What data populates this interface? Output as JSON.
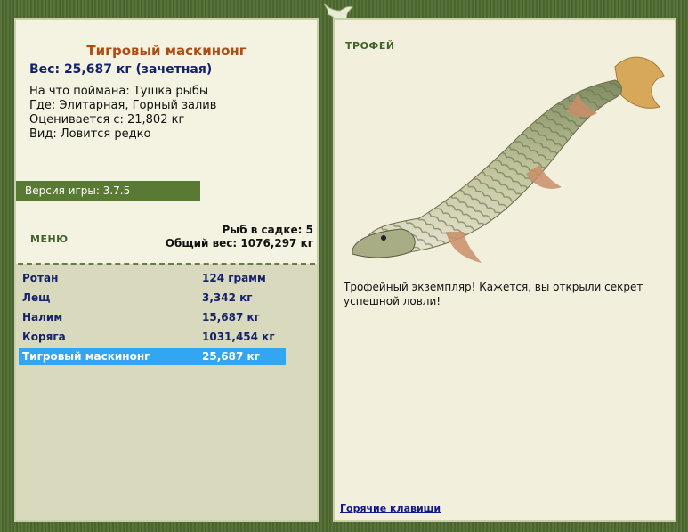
{
  "fish": {
    "title": "Тигровый маскинонг",
    "weight": "Вес: 25,687 кг (зачетная)",
    "caught_on": "На что поймана: Тушка рыбы",
    "location": "Где: Элитарная, Горный залив",
    "valued": "Оценивается с: 21,802 кг",
    "kind": "Вид: Ловится редко"
  },
  "version": "Версия игры: 3.7.5",
  "menu": {
    "label": "МЕНЮ"
  },
  "stats": {
    "count": "Рыб в садке: 5",
    "total": "Общий вес: 1076,297 кг"
  },
  "catch_list": [
    {
      "name": "Ротан",
      "weight": "124 грамм"
    },
    {
      "name": "Лещ",
      "weight": "3,342 кг"
    },
    {
      "name": "Налим",
      "weight": "15,687 кг"
    },
    {
      "name": "Коряга",
      "weight": "1031,454 кг"
    },
    {
      "name": "Тигровый маскинонг",
      "weight": "25,687 кг"
    }
  ],
  "trophy": {
    "label": "ТРОФЕЙ",
    "text": "Трофейный экземпляр! Кажется, вы открыли секрет успешной ловли!"
  },
  "hotkeys": "Горячие клавиши",
  "icons": {
    "logo": "fish-logo-icon",
    "trophy_image": "muskellunge-fish-image"
  },
  "colors": {
    "accent_green": "#587a34",
    "title_orange": "#b14a10",
    "text_navy": "#14216b",
    "selection_blue": "#33a6f1"
  }
}
